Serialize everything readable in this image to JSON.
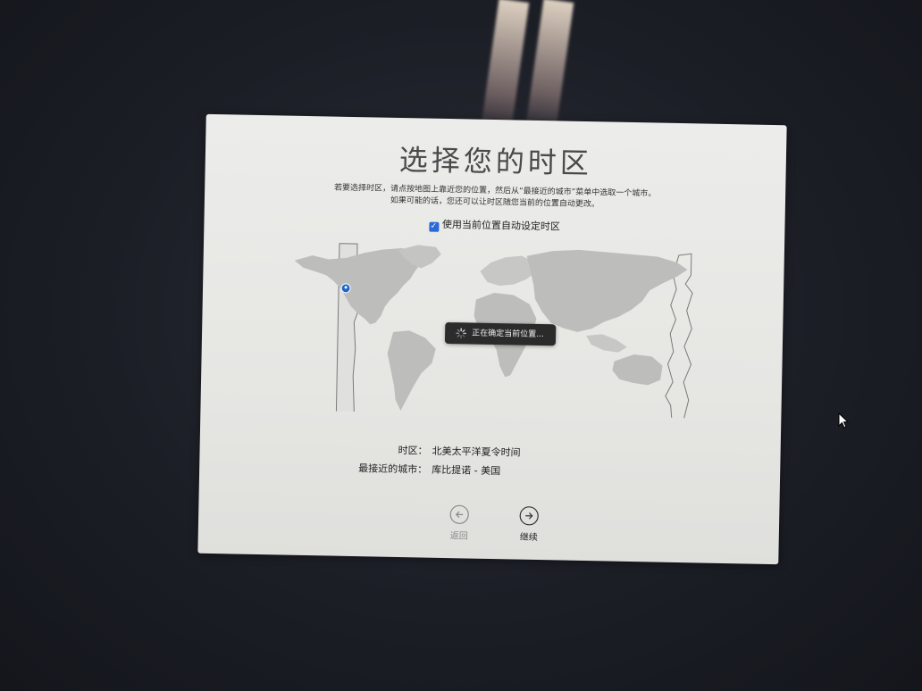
{
  "dialog": {
    "title": "选择您的时区",
    "instructions_line1": "若要选择时区，请点按地图上靠近您的位置，然后从“最接近的城市”菜单中选取一个城市。",
    "instructions_line2": "如果可能的话，您还可以让时区随您当前的位置自动更改。",
    "auto_timezone_label": "使用当前位置自动设定时区",
    "auto_timezone_checked": true,
    "locating_message": "正在确定当前位置...",
    "timezone_label": "时区：",
    "timezone_value": "北美太平洋夏令时间",
    "closest_city_label": "最接近的城市：",
    "closest_city_value": "库比提诺 - 美国",
    "back_label": "返回",
    "continue_label": "继续"
  },
  "colors": {
    "accent": "#2a6ad8",
    "panel_bg": "#e9e9e6",
    "land": "#bdbdbb",
    "selected_band": "#e0e0de"
  },
  "icons": {
    "checkbox": "checkmark-icon",
    "spinner": "spinner-icon",
    "back": "arrow-left-circle-icon",
    "continue": "arrow-right-circle-icon",
    "pin": "location-pin-icon",
    "cursor": "mouse-pointer-icon"
  }
}
